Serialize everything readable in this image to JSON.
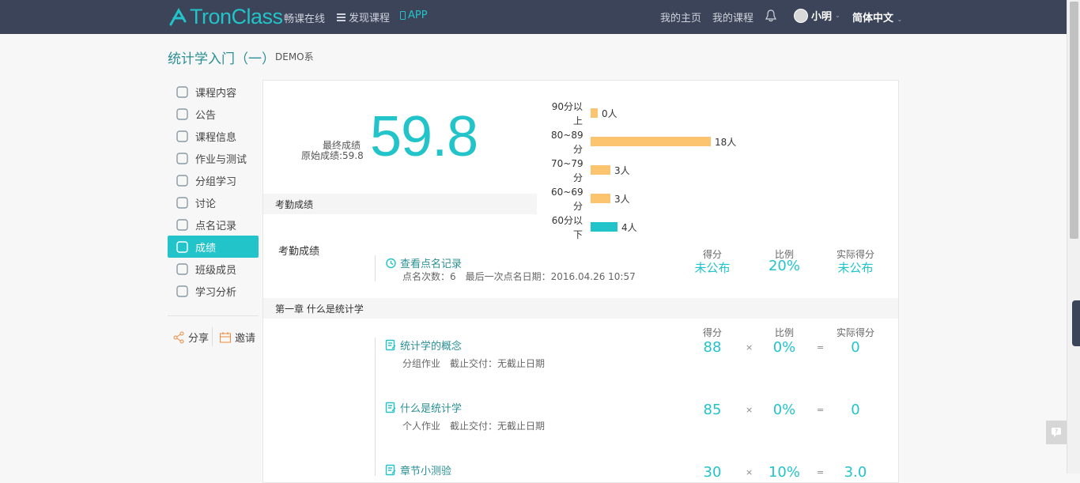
{
  "header": {
    "logo_text": "TronClass",
    "slogan": "畅课在线",
    "discover": "发现课程",
    "app": "APP",
    "my_home": "我的主页",
    "my_courses": "我的课程",
    "username": "小明",
    "language": "简体中文"
  },
  "course": {
    "title": "统计学入门（一）",
    "dept": "DEMO系"
  },
  "sidebar": {
    "items": [
      {
        "label": "课程内容",
        "icon": "course-content-icon"
      },
      {
        "label": "公告",
        "icon": "announcement-icon"
      },
      {
        "label": "课程信息",
        "icon": "course-info-icon"
      },
      {
        "label": "作业与测试",
        "icon": "homework-icon"
      },
      {
        "label": "分组学习",
        "icon": "group-icon"
      },
      {
        "label": "讨论",
        "icon": "discussion-icon"
      },
      {
        "label": "点名记录",
        "icon": "roll-call-icon"
      },
      {
        "label": "成绩",
        "icon": "trophy-icon"
      },
      {
        "label": "班级成员",
        "icon": "members-icon"
      },
      {
        "label": "学习分析",
        "icon": "analysis-icon"
      }
    ],
    "active_index": 7,
    "share": "分享",
    "invite": "邀请"
  },
  "score": {
    "final_label": "最终成绩",
    "original_label": "原始成绩:59.8",
    "final_value": "59.8"
  },
  "distribution": [
    {
      "label": "90分以上",
      "count": 0,
      "text": "0人",
      "color": "#fcc46f"
    },
    {
      "label": "80~89分",
      "count": 18,
      "text": "18人",
      "color": "#fcc46f"
    },
    {
      "label": "70~79分",
      "count": 3,
      "text": "3人",
      "color": "#fcc46f"
    },
    {
      "label": "60~69分",
      "count": 3,
      "text": "3人",
      "color": "#fcc46f"
    },
    {
      "label": "60分以下",
      "count": 4,
      "text": "4人",
      "color": "#22c4c9"
    }
  ],
  "attendance": {
    "band": "考勤成绩",
    "title": "考勤成绩",
    "link": "查看点名记录",
    "meta": "点名次数：6　最后一次点名日期：2016.04.26 10:57",
    "headers": [
      "得分",
      "比例",
      "实际得分"
    ],
    "score": "未公布",
    "ratio": "20%",
    "actual": "未公布"
  },
  "chapter": {
    "band": "第一章 什么是统计学",
    "headers": [
      "得分",
      "比例",
      "实际得分"
    ],
    "rows": [
      {
        "title": "统计学的概念",
        "meta": "分组作业　截止交付：无截止日期",
        "score": "88",
        "ratio": "0%",
        "actual": "0"
      },
      {
        "title": "什么是统计学",
        "meta": "个人作业　截止交付：无截止日期",
        "score": "85",
        "ratio": "0%",
        "actual": "0"
      },
      {
        "title": "章节小测验",
        "meta": "",
        "score": "30",
        "ratio": "10%",
        "actual": "3.0"
      }
    ],
    "times": "×",
    "equals": "="
  },
  "colors": {
    "accent": "#22c4c9",
    "topbar": "#3c4459",
    "bar": "#fcc46f"
  }
}
